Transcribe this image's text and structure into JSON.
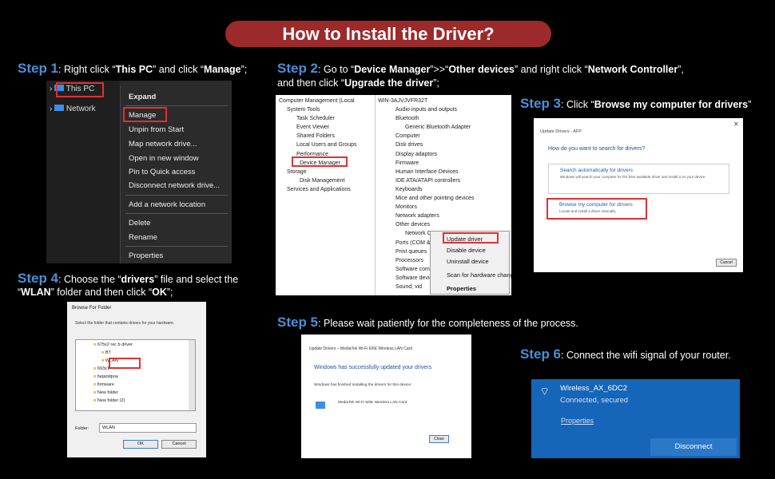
{
  "title": "How to Install the Driver?",
  "steps": {
    "s1": {
      "num": "Step 1",
      "a": ": Right click “",
      "b": "This PC",
      "c": "” and click “",
      "d": "Manage",
      "e": "”;"
    },
    "s2": {
      "num": "Step 2",
      "a": ": Go to “",
      "b": "Device Manager",
      "c": "”>>“",
      "d": "Other devices",
      "e": "” and right click “",
      "f": "Network Controller",
      "g": "”,",
      "h": "and then click “",
      "i": "Upgrade the driver",
      "j": "”;"
    },
    "s3": {
      "num": "Step 3",
      "a": ": Click “",
      "b": "Browse my computer for drivers",
      "c": "”"
    },
    "s4": {
      "num": "Step 4",
      "a": ": Choose the “",
      "b": "drivers",
      "c": "” file and select the",
      "d": "“",
      "e": "WLAN",
      "f": "” folder and  then click “",
      "g": "OK",
      "h": "”;"
    },
    "s5": {
      "num": "Step 5",
      "a": ": Please wait patiently for the completeness of the process."
    },
    "s6": {
      "num": "Step 6",
      "a": ": Connect the wifi signal of your router."
    }
  },
  "shot1": {
    "tree": [
      "This PC",
      "Network"
    ],
    "menu": [
      "Expand",
      "Manage",
      "Unpin from Start",
      "Map network drive...",
      "Open in new window",
      "Pin to Quick access",
      "Disconnect network drive...",
      "Add a network location",
      "Delete",
      "Rename",
      "Properties"
    ]
  },
  "shot2": {
    "left": [
      "Computer Management (Local",
      "System Tools",
      "Task Scheduler",
      "Event Viewer",
      "Shared Folders",
      "Local Users and Groups",
      "Performance",
      "Device Manager",
      "Storage",
      "Disk Management",
      "Services and Applications"
    ],
    "right": [
      "WIN-3AJVJVFR32T",
      "Audio inputs and outputs",
      "Bluetooth",
      "Generic Bluetooth Adapter",
      "Computer",
      "Disk drives",
      "Display adaptors",
      "Firmware",
      "Human Interface Devices",
      "IDE ATA/ATAPI controllers",
      "Keyboards",
      "Mice and other pointing devices",
      "Monitors",
      "Network adapters",
      "Other devices",
      "Network C",
      "Ports (COM &",
      "Print queues",
      "Processors",
      "Software com",
      "Software devic",
      "Sound, vid"
    ],
    "ctx": [
      "Update driver",
      "Disable device",
      "Uninstall device",
      "Scan for hardware chang",
      "Properties"
    ]
  },
  "shot3": {
    "header": "Update Drivers - AFP",
    "question": "How do you want to search for drivers?",
    "opt1_title": "Search automatically for drivers",
    "opt1_desc": "Windows will search your computer for the best available driver and install it on your device.",
    "opt2_title": "Browse my computer for drivers",
    "opt2_desc": "Locate and install a driver manually.",
    "cancel": "Cancel"
  },
  "shot4": {
    "title": "Browse For Folder",
    "desc": "Select the folder that contains drivers for your hardware.",
    "items": [
      "675x2 rec b driver",
      "BT",
      "WLAN",
      "693x1",
      "faqandpoa",
      "firmware",
      "New folder",
      "New folder (2)"
    ],
    "folder_label": "Folder:",
    "folder_value": "WLAN",
    "ok": "OK",
    "cancel": "Cancel"
  },
  "shot5": {
    "header": "Update Drivers – MediaTek Wi-Fi 6/6E Wireless LAN Card",
    "success": "Windows has successfully updated your drivers",
    "finished": "Windows has finished installing the drivers for this device:",
    "device": "MediaTek Wi-Fi 6/6E Wireless LAN Card",
    "close": "Close"
  },
  "shot6": {
    "ssid": "Wireless_AX_6DC2",
    "status": "Connected, secured",
    "properties": "Properties",
    "disconnect": "Disconnect"
  }
}
